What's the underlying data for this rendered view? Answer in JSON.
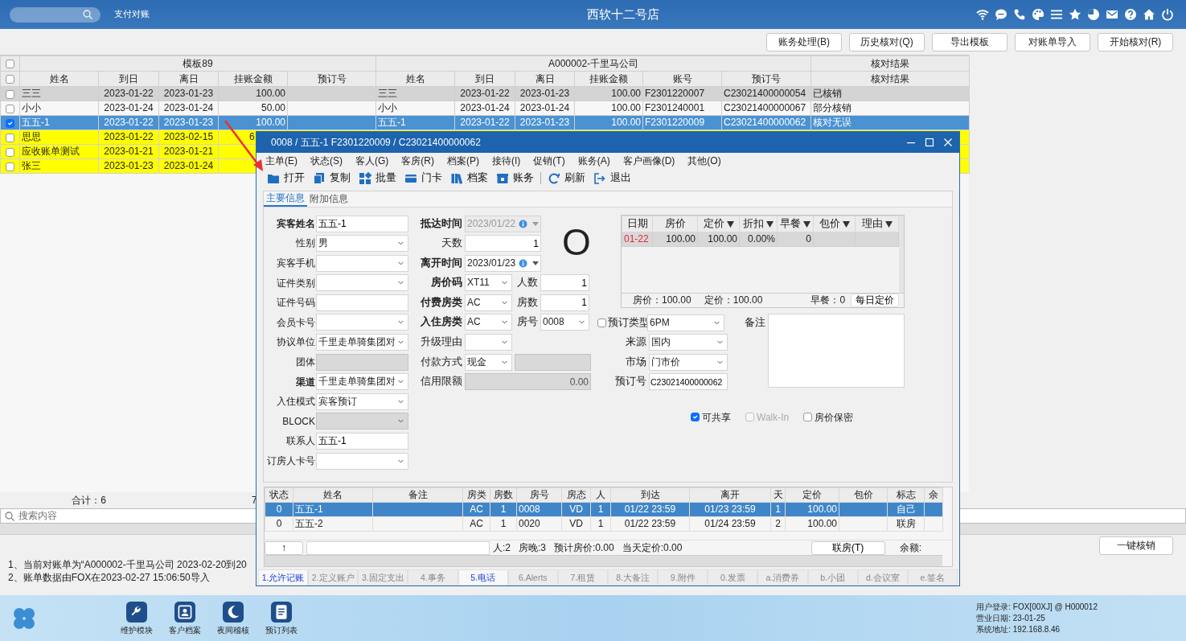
{
  "header": {
    "module": "支付对账",
    "title": "西软十二号店"
  },
  "toolbar": {
    "buttons": [
      "账务处理(B)",
      "历史核对(Q)",
      "导出模板",
      "对账单导入",
      "开始核对(R)"
    ]
  },
  "table": {
    "header_checkboxes": [
      {
        "checked": false
      },
      {
        "checked": false
      }
    ],
    "groups": [
      {
        "label": "模板89",
        "columns": [
          "姓名",
          "到日",
          "离日",
          "挂账金额",
          "预订号"
        ]
      },
      {
        "label": "A000002-千里马公司",
        "columns": [
          "姓名",
          "到日",
          "离日",
          "挂账金额",
          "账号",
          "预订号"
        ]
      },
      {
        "label": "核对结果",
        "columns": [
          "核对结果"
        ]
      }
    ],
    "rows": [
      {
        "kind": "settled",
        "checked": false,
        "selected": false,
        "cells": [
          "三三",
          "2023-01-22",
          "2023-01-23",
          "100.00",
          null,
          "三三",
          "2023-01-22",
          "2023-01-23",
          "100.00",
          "F2301220007",
          "C23021400000054",
          "已核销"
        ]
      },
      {
        "kind": "partial",
        "checked": false,
        "selected": false,
        "cells": [
          "小小",
          "2023-01-24",
          "2023-01-24",
          "50.00",
          null,
          "小小",
          "2023-01-24",
          "2023-01-24",
          "100.00",
          "F2301240001",
          "C23021400000067",
          "部分核销"
        ]
      },
      {
        "kind": "matched",
        "checked": true,
        "selected": true,
        "cells": [
          "五五-1",
          "2023-01-22",
          "2023-01-23",
          "100.00",
          null,
          "五五-1",
          "2023-01-22",
          "2023-01-23",
          "100.00",
          "F2301220009",
          "C23021400000062",
          "核对无误"
        ]
      },
      {
        "kind": "unmatched",
        "checked": false,
        "selected": false,
        "cells": [
          "思思",
          "2023-01-22",
          "2023-02-15",
          "6"
        ]
      },
      {
        "kind": "unmatched",
        "checked": false,
        "selected": false,
        "cells": [
          "应收账单测试",
          "2023-01-21",
          "2023-01-21"
        ]
      },
      {
        "kind": "unmatched",
        "checked": false,
        "selected": false,
        "cells": [
          "张三",
          "2023-01-23",
          "2023-01-24"
        ]
      }
    ],
    "summary": {
      "total": "合计：6",
      "amount": "7"
    }
  },
  "search": {
    "placeholder": "搜索内容"
  },
  "action_button": "一键核销",
  "messages": [
    "1、当前对账单为“A000002-千里马公司 2023-02-20到20",
    "2、账单数据由FOX在2023-02-27 15:06:50导入"
  ],
  "dialog": {
    "title": "0008 / 五五-1 F2301220009 / C23021400000062",
    "menu": [
      "主单(E)",
      "状态(S)",
      "客人(G)",
      "客房(R)",
      "档案(P)",
      "接待(I)",
      "促销(T)",
      "账务(A)",
      "客户画像(D)",
      "其他(O)"
    ],
    "toolbar": [
      [
        "打开",
        "复制",
        "批量",
        "门卡",
        "档案",
        "账务"
      ],
      [
        "刷新",
        "退出"
      ]
    ],
    "tabs": [
      {
        "label": "主要信息",
        "selected": true
      },
      {
        "label": "附加信息",
        "selected": false
      }
    ],
    "left_fields": [
      {
        "label": "宾客姓名",
        "required": true,
        "kind": "text",
        "value": "五五-1",
        "disabled": false
      },
      {
        "label": "性别",
        "required": false,
        "kind": "select",
        "value": "男",
        "disabled": false
      },
      {
        "label": "宾客手机",
        "required": false,
        "kind": "select",
        "disabled": false
      },
      {
        "label": "证件类别",
        "required": false,
        "kind": "select",
        "disabled": false
      },
      {
        "label": "证件号码",
        "required": false,
        "kind": "text",
        "disabled": false
      },
      {
        "label": "会员卡号",
        "required": false,
        "kind": "select",
        "disabled": false
      },
      {
        "label": "协议单位",
        "required": false,
        "kind": "select",
        "value": "千里走单骑集团对",
        "disabled": false
      },
      {
        "label": "团体",
        "required": false,
        "kind": "text",
        "disabled": true
      },
      {
        "label": "渠道",
        "required": true,
        "kind": "select",
        "value": "千里走单骑集团对",
        "disabled": false
      },
      {
        "label": "入住模式",
        "required": false,
        "kind": "select",
        "value": "宾客预订",
        "disabled": false
      },
      {
        "label": "BLOCK",
        "required": false,
        "kind": "select",
        "disabled": true
      },
      {
        "label": "联系人",
        "required": false,
        "kind": "text",
        "value": "五五-1",
        "disabled": false
      },
      {
        "label": "订房人卡号",
        "required": false,
        "kind": "select",
        "disabled": false
      }
    ],
    "middle_fields": [
      {
        "label": "抵达时间",
        "required": true,
        "kind": "date",
        "value": "2023/01/22",
        "disabled": true
      },
      {
        "label": "天数",
        "required": false,
        "kind": "text",
        "value": "1",
        "disabled": false
      },
      {
        "label": "离开时间",
        "required": true,
        "kind": "date",
        "value": "2023/01/23",
        "disabled": false
      },
      {
        "label": "房价码",
        "required": true,
        "kind": "select",
        "value": "XT11",
        "disabled": false,
        "side": {
          "label": "人数",
          "kind": "text",
          "value": "1",
          "disabled": false
        }
      },
      {
        "label": "付费房类",
        "required": true,
        "kind": "select",
        "value": "AC",
        "disabled": false,
        "side": {
          "label": "房数",
          "kind": "text",
          "value": "1",
          "disabled": false
        }
      },
      {
        "label": "入住房类",
        "required": true,
        "kind": "select",
        "value": "AC",
        "disabled": false,
        "side": {
          "label": "房号",
          "kind": "select",
          "value": "0008",
          "disabled": false
        }
      },
      {
        "label": "升级理由",
        "required": false,
        "kind": "select",
        "disabled": false
      },
      {
        "label": "付款方式",
        "required": false,
        "kind": "select",
        "value": "现金",
        "disabled": false,
        "side": {
          "kind": "text",
          "disabled": true
        }
      },
      {
        "label": "信用限额",
        "required": false,
        "kind": "text",
        "value": "0.00",
        "disabled": true
      }
    ],
    "status_glyph": "O",
    "price_grid": {
      "columns": [
        {
          "label": "日期",
          "filter": false
        },
        {
          "label": "房价",
          "filter": false
        },
        {
          "label": "定价",
          "filter": true
        },
        {
          "label": "折扣",
          "filter": true
        },
        {
          "label": "早餐",
          "filter": true
        },
        {
          "label": "包价",
          "filter": true
        },
        {
          "label": "理由",
          "filter": true
        }
      ],
      "rows": [
        {
          "cells": [
            "01-22",
            "100.00",
            "100.00",
            "0.00%",
            "0",
            null,
            null
          ]
        }
      ],
      "footer": [
        "房价：100.00",
        "定价：100.00",
        "早餐：0"
      ],
      "button": "每日定价"
    },
    "booking_type": {
      "checked": false,
      "label": "预订类型",
      "value": "6PM"
    },
    "booking_fields": [
      {
        "label": "来源",
        "kind": "select",
        "value": "国内"
      },
      {
        "label": "市场",
        "kind": "select",
        "value": "门市价"
      },
      {
        "label": "预订号",
        "kind": "text",
        "value": "C23021400000062"
      }
    ],
    "remark": {
      "label": "备注"
    },
    "options": [
      {
        "label": "可共享",
        "checked": true,
        "disabled": false
      },
      {
        "label": "Walk-In",
        "checked": false,
        "disabled": true
      },
      {
        "label": "房价保密",
        "checked": false,
        "disabled": false
      }
    ],
    "guests": {
      "columns": [
        "状态",
        "姓名",
        "备注",
        "房类",
        "房数",
        "房号",
        "房态",
        "人",
        "到达",
        "离开",
        "天",
        "定价",
        "包价",
        "标志",
        "余"
      ],
      "rows": [
        {
          "selected": true,
          "cells": [
            "0",
            "五五-1",
            null,
            "AC",
            "1",
            "0008",
            "VD",
            "1",
            "01/22 23:59",
            "01/23 23:59",
            "1",
            "100.00",
            null,
            "自己",
            null
          ]
        },
        {
          "selected": false,
          "cells": [
            "0",
            "五五-2",
            null,
            "AC",
            "1",
            "0020",
            "VD",
            "1",
            "01/22 23:59",
            "01/24 23:59",
            "2",
            "100.00",
            null,
            "联房",
            null
          ]
        }
      ],
      "up_button": "↑",
      "stats": [
        "人:2",
        "房晚:3",
        "预计房价:0.00",
        "当天定价:0.00"
      ],
      "link_button": "联房(T)",
      "balance_label": "余额:"
    },
    "bottom_tabs": [
      {
        "label": "1.允许记账",
        "highlighted": true
      },
      {
        "label": "2.定义账户",
        "highlighted": false
      },
      {
        "label": "3.固定支出",
        "highlighted": false
      },
      {
        "label": "4.事务",
        "highlighted": false
      },
      {
        "label": "5.电话",
        "highlighted": true
      },
      {
        "label": "6.Alerts",
        "highlighted": false
      },
      {
        "label": "7.租赁",
        "highlighted": false
      },
      {
        "label": "8.大备注",
        "highlighted": false
      },
      {
        "label": "9.附件",
        "highlighted": false
      },
      {
        "label": "0.发票",
        "highlighted": false
      },
      {
        "label": "a.消费券",
        "highlighted": false
      },
      {
        "label": "b.小团",
        "highlighted": false
      },
      {
        "label": "d.会议室",
        "highlighted": false
      },
      {
        "label": "e.签名",
        "highlighted": false
      }
    ]
  },
  "taskbar": {
    "apps": [
      "维护模块",
      "客户档案",
      "夜间稽核",
      "预订列表"
    ],
    "info": [
      "用户登录: FOX[00XJ] @ H000012",
      "营业日期: 23-01-25",
      "系统地址: 192.168.8.46"
    ]
  }
}
